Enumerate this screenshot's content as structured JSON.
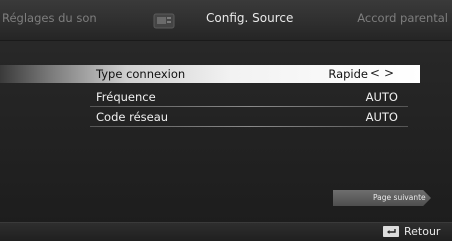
{
  "tabs": {
    "left": "Réglages du son",
    "center": "Config. Source",
    "right": "Accord parental"
  },
  "menu": [
    {
      "label": "Type connexion",
      "value": "Rapide",
      "selected": true
    },
    {
      "label": "Fréquence",
      "value": "AUTO",
      "selected": false
    },
    {
      "label": "Code réseau",
      "value": "AUTO",
      "selected": false
    }
  ],
  "next_page_label": "Page suivante",
  "footer": {
    "back_label": "Retour"
  },
  "icons": {
    "source_tab": "source-icon",
    "nav_arrows": "left-right-arrows-icon",
    "back": "return-key-icon"
  },
  "colors": {
    "selected_row": "#ffffff",
    "background": "#262626",
    "active_tab_text": "#e9e9e9",
    "inactive_tab_text": "#7e7e7e"
  }
}
